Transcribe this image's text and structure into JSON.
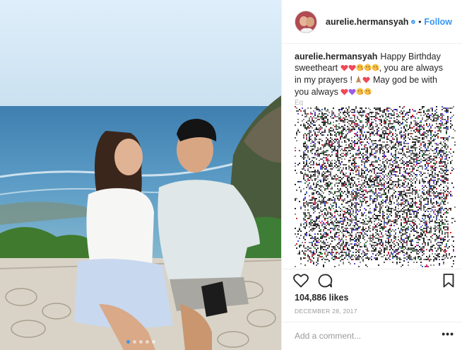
{
  "post": {
    "username": "aurelie.hermansyah",
    "verified_icon": "verified-badge-icon",
    "separator": "•",
    "follow_label": "Follow",
    "caption": {
      "username": "aurelie.hermansyah",
      "text_1": "Happy Birthday sweetheart",
      "text_2": ", you are always in my prayers !",
      "text_3": "May god be with you always",
      "emojis": [
        "heart",
        "heart",
        "kiss-face",
        "kiss-face",
        "kiss-face",
        "folded-hands",
        "heart",
        "purple-heart",
        "purple-heart",
        "kiss-face",
        "kiss-face"
      ]
    },
    "comment_preview_label": "Eq",
    "likes": "104,886 likes",
    "date": "DECEMBER 28, 2017",
    "comment_placeholder": "Add a comment...",
    "more_label": "•••",
    "carousel": {
      "count": 5,
      "active_index": 0
    }
  },
  "icons": {
    "like": "heart-outline-icon",
    "comment": "comment-bubble-icon",
    "save": "bookmark-icon",
    "more": "more-options-icon"
  },
  "colors": {
    "accent": "#3897f0",
    "text": "#262626",
    "muted": "#999999",
    "border": "#efefef",
    "heart_emoji": "#ed4956",
    "purple_emoji": "#9b5de5",
    "kiss_emoji": "#f5c041"
  }
}
